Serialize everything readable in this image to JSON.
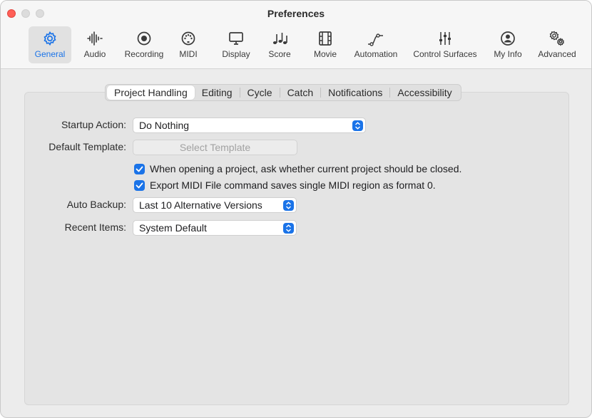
{
  "window": {
    "title": "Preferences"
  },
  "toolbar": {
    "items": [
      {
        "label": "General",
        "icon": "gear-icon",
        "selected": true
      },
      {
        "label": "Audio",
        "icon": "waveform-icon"
      },
      {
        "label": "Recording",
        "icon": "record-icon"
      },
      {
        "label": "MIDI",
        "icon": "midi-port-icon"
      },
      {
        "label": "Display",
        "icon": "monitor-icon"
      },
      {
        "label": "Score",
        "icon": "music-notes-icon"
      },
      {
        "label": "Movie",
        "icon": "film-icon"
      },
      {
        "label": "Automation",
        "icon": "automation-curve-icon"
      },
      {
        "label": "Control Surfaces",
        "icon": "faders-icon"
      },
      {
        "label": "My Info",
        "icon": "person-icon"
      },
      {
        "label": "Advanced",
        "icon": "gears-icon"
      }
    ]
  },
  "tabs": {
    "items": [
      "Project Handling",
      "Editing",
      "Cycle",
      "Catch",
      "Notifications",
      "Accessibility"
    ],
    "selected": "Project Handling"
  },
  "form": {
    "startup_action": {
      "label": "Startup Action:",
      "value": "Do Nothing"
    },
    "default_template": {
      "label": "Default Template:",
      "button": "Select Template"
    },
    "check_close_project": {
      "label": "When opening a project, ask whether current project should be closed.",
      "checked": true
    },
    "check_export_midi": {
      "label": "Export MIDI File command saves single MIDI region as format 0.",
      "checked": true
    },
    "auto_backup": {
      "label": "Auto Backup:",
      "value": "Last 10 Alternative Versions"
    },
    "recent_items": {
      "label": "Recent Items:",
      "value": "System Default"
    }
  },
  "colors": {
    "accent": "#1a73e8",
    "close_light": "#ff5f57"
  }
}
